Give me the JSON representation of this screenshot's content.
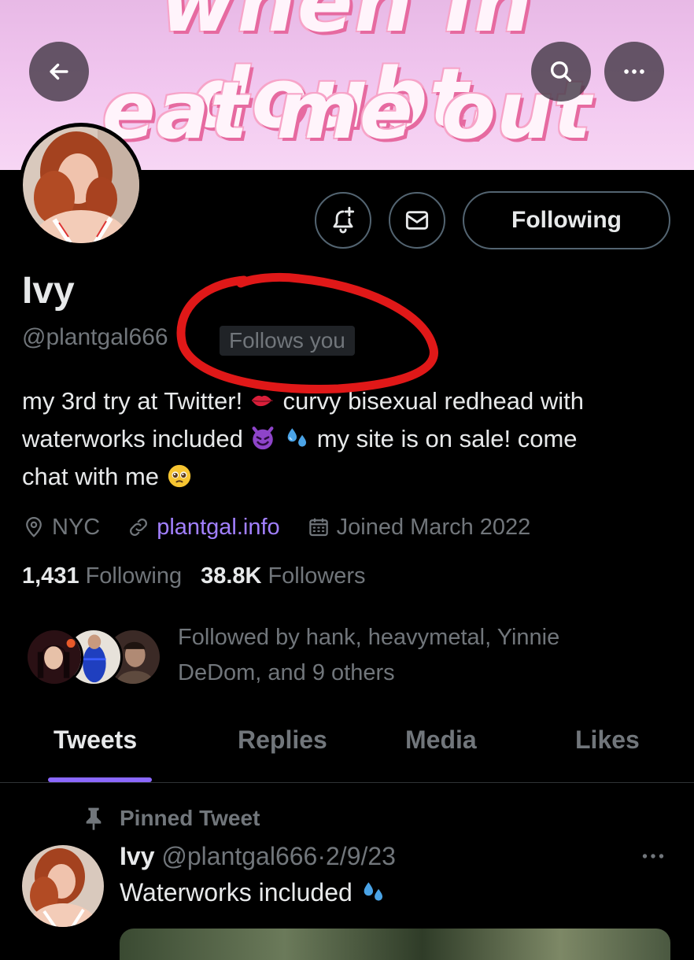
{
  "banner": {
    "line1": "when in doubt,",
    "line2": "eat me out"
  },
  "header": {
    "back_icon": "arrow-left-icon",
    "search_icon": "search-icon",
    "more_icon": "more-horizontal-icon"
  },
  "actions": {
    "notify_icon": "bell-plus-icon",
    "message_icon": "envelope-icon",
    "following_label": "Following"
  },
  "profile": {
    "name": "Ivy",
    "handle": "@plantgal666",
    "follows_you": "Follows you",
    "bio": {
      "line1_a": "my 3rd try at Twitter!",
      "line1_b": " curvy bisexual redhead with",
      "line2_a": "waterworks included ",
      "line2_b": " my site is on sale! come",
      "line3": "chat with me "
    },
    "location": "NYC",
    "website": "plantgal.info",
    "joined": "Joined March 2022",
    "following_count": "1,431",
    "following_label": "Following",
    "followers_count": "38.8K",
    "followers_label": "Followers",
    "followed_by_line1": "Followed by hank, heavymetal, Yinnie",
    "followed_by_line2": "DeDom, and 9 others"
  },
  "tabs": [
    {
      "label": "Tweets",
      "active": true
    },
    {
      "label": "Replies",
      "active": false
    },
    {
      "label": "Media",
      "active": false
    },
    {
      "label": "Likes",
      "active": false
    }
  ],
  "pinned_tweet": {
    "pinned_label": "Pinned Tweet",
    "author_name": "Ivy",
    "author_handle": "@plantgal666",
    "separator": "·",
    "date": "2/9/23",
    "text": "Waterworks included "
  },
  "colors": {
    "accent": "#8b68ff",
    "link": "#a280ff",
    "muted": "#71767b",
    "annotation": "#e01818"
  }
}
